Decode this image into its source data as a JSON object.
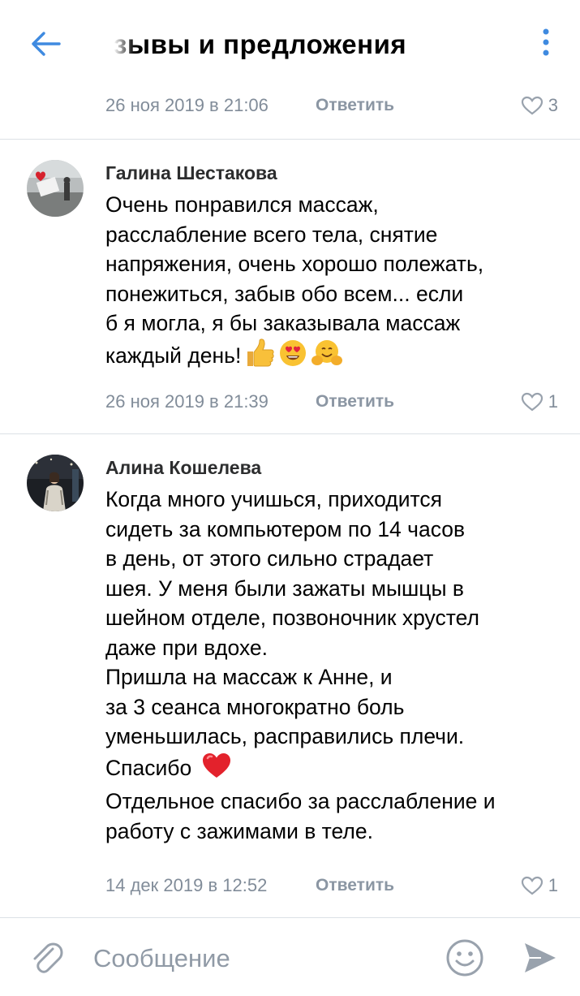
{
  "header": {
    "title": "зывы и предложения",
    "back_icon": "arrow-left-icon",
    "more_icon": "vertical-dots-icon",
    "accent_color": "#3f8ae0"
  },
  "top_comment_meta": {
    "date": "26 ноя 2019 в 21:06",
    "reply_label": "Ответить",
    "likes": "3"
  },
  "comments": [
    {
      "author": "Галина Шестакова",
      "lines": [
        "Очень понравился массаж,",
        "расслабление всего тела, снятие",
        "напряжения, очень хорошо полежать,",
        "понежиться, забыв обо всем... если",
        "б я могла, я бы заказывала массаж",
        "каждый день!"
      ],
      "emojis": [
        "thumbs-up-icon",
        "heart-eyes-icon",
        "hugging-face-icon"
      ],
      "date": "26 ноя 2019 в 21:39",
      "reply_label": "Ответить",
      "likes": "1"
    },
    {
      "author": "Алина Кошелева",
      "lines": [
        "Когда много учишься, приходится",
        "сидеть за компьютером по 14 часов",
        "в день, от этого сильно страдает",
        "шея. У меня были зажаты мышцы в",
        "шейном отделе, позвоночник хрустел",
        "даже при вдохе.",
        "Пришла на массаж к Анне, и",
        "за 3 сеанса многократно боль",
        "уменьшилась, расправились плечи.",
        "Спасибо",
        "Отдельное спасибо за расслабление и",
        "работу с зажимами в теле."
      ],
      "emojis": [
        "red-heart-icon"
      ],
      "date": "14 дек 2019 в 12:52",
      "reply_label": "Ответить",
      "likes": "1"
    }
  ],
  "composer": {
    "placeholder": "Сообщение",
    "attach_icon": "paperclip-icon",
    "smile_icon": "smile-icon",
    "send_icon": "send-icon"
  },
  "colors": {
    "meta_gray": "#818c99",
    "divider": "#dce1e6",
    "icon_gray": "#99a2ad"
  }
}
